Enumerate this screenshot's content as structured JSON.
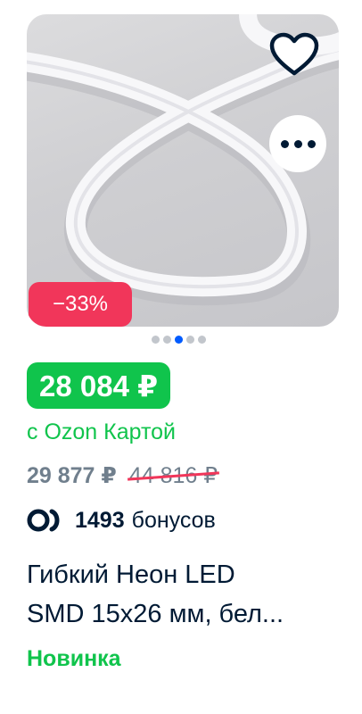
{
  "product": {
    "image_alt": "белая гибкая неоновая лента",
    "discount": "−33%",
    "gallery_dots": {
      "count": 5,
      "active": 3
    },
    "price_card": "28 084 ₽",
    "price_card_label": "с Ozon Картой",
    "price_regular": "29 877 ₽",
    "price_old": "44 816 ₽",
    "bonus_count": "1493",
    "bonus_label": "бонусов",
    "title": "Гибкий Неон LED\nSMD 15x26 мм, бел...",
    "badge": "Новинка"
  },
  "colors": {
    "discount": "#f1365a",
    "price_green": "#10c44c",
    "dot_active": "#005bff",
    "text": "#001a34",
    "muted": "#707f8d"
  },
  "icons": {
    "favorite": "heart-outline-icon",
    "more": "more-dots-icon",
    "bonus": "ozon-bonus-icon"
  }
}
